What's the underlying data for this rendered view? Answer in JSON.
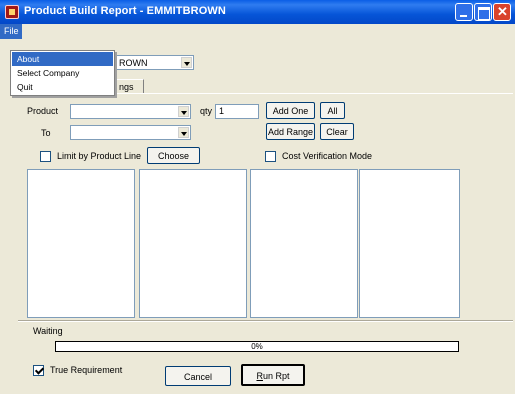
{
  "window": {
    "title": "Product Build Report - EMMITBROWN"
  },
  "menubar": {
    "file_label": "File"
  },
  "file_menu": {
    "items": [
      "About",
      "Select Company",
      "Quit"
    ],
    "highlighted": "About"
  },
  "company_combo": {
    "value": "ROWN"
  },
  "tabs": [
    {
      "label": "ngs"
    }
  ],
  "form": {
    "product_label": "Product",
    "product_value": "",
    "qty_label": "qty",
    "qty_value": "1",
    "add_one_label": "Add One",
    "all_label": "All",
    "to_label": "To",
    "to_value": "",
    "add_range_label": "Add Range",
    "clear_label": "Clear",
    "limit_label": "Limit by Product Line",
    "limit_checked": false,
    "choose_label": "Choose",
    "cost_verification_label": "Cost Verification Mode",
    "cost_verification_checked": false
  },
  "status": {
    "waiting_label": "Waiting",
    "progress_percent": 0,
    "progress_text": "0%"
  },
  "footer": {
    "true_requirement_label": "True Requirement",
    "true_requirement_checked": true,
    "cancel_label": "Cancel",
    "run_label": "Run Rpt",
    "run_mnemonic": "R",
    "run_rest": "un Rpt"
  },
  "colors": {
    "accent": "#316ac5",
    "title_bar": "#0a5ee6",
    "face": "#ece9d8"
  }
}
